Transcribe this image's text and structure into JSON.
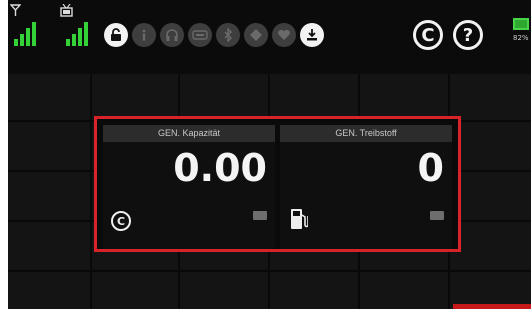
{
  "status_bar": {
    "signal_indicators": [
      {
        "icon": "antenna-icon",
        "level": 4,
        "color": "#35d138"
      },
      {
        "icon": "tv-receiver-icon",
        "level": 4,
        "color": "#35d138"
      }
    ],
    "function_icons": [
      {
        "icon": "unlock-icon",
        "state": "active"
      },
      {
        "icon": "info-icon",
        "state": "inactive"
      },
      {
        "icon": "headphones-icon",
        "state": "inactive"
      },
      {
        "icon": "timer-icon",
        "state": "inactive"
      },
      {
        "icon": "bluetooth-icon",
        "state": "inactive"
      },
      {
        "icon": "navigation-icon",
        "state": "inactive"
      },
      {
        "icon": "heart-icon",
        "state": "inactive"
      },
      {
        "icon": "download-icon",
        "state": "active"
      }
    ],
    "copyright_button": "C",
    "help_button": "?",
    "battery": {
      "percent_text": "82%",
      "color": "#47d448"
    }
  },
  "widget": {
    "border_color": "#d9232b",
    "panels": [
      {
        "title": "GEN. Kapazität",
        "value": "0.00",
        "icon": "copyright-icon",
        "unit_badge": "unit-badge"
      },
      {
        "title": "GEN. Treibstoff",
        "value": "0",
        "icon": "fuel-pump-icon",
        "unit_badge": "unit-badge"
      }
    ]
  }
}
